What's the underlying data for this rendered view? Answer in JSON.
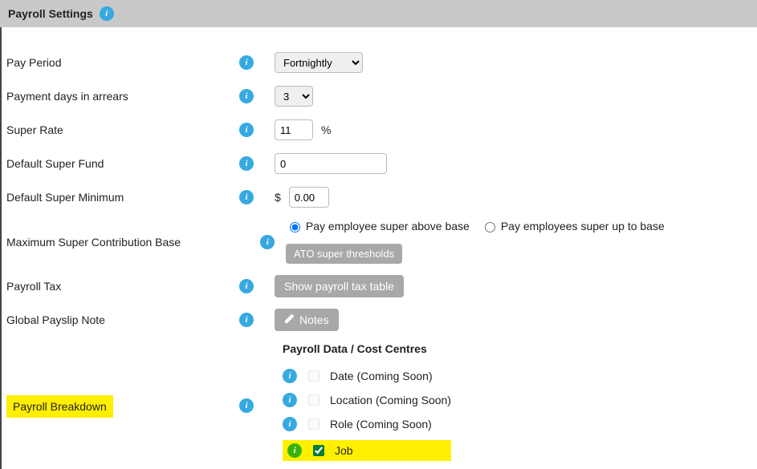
{
  "header": {
    "title": "Payroll Settings"
  },
  "rows": {
    "payPeriod": {
      "label": "Pay Period",
      "value": "Fortnightly"
    },
    "arrears": {
      "label": "Payment days in arrears",
      "value": "3"
    },
    "superRate": {
      "label": "Super Rate",
      "value": "11",
      "suffix": "%"
    },
    "superFund": {
      "label": "Default Super Fund",
      "value": "0"
    },
    "superMin": {
      "label": "Default Super Minimum",
      "prefix": "$",
      "value": "0.00"
    },
    "maxBase": {
      "label": "Maximum Super Contribution Base",
      "opt1": "Pay employee super above base",
      "opt2": "Pay employees super up to base",
      "button": "ATO super thresholds"
    },
    "payrollTax": {
      "label": "Payroll Tax",
      "button": "Show payroll tax table"
    },
    "payslipNote": {
      "label": "Global Payslip Note",
      "button": "Notes"
    },
    "breakdown": {
      "label": "Payroll Breakdown",
      "header": "Payroll Data / Cost Centres",
      "items": {
        "date": "Date (Coming Soon)",
        "location": "Location (Coming Soon)",
        "role": "Role (Coming Soon)",
        "job": "Job"
      }
    }
  }
}
